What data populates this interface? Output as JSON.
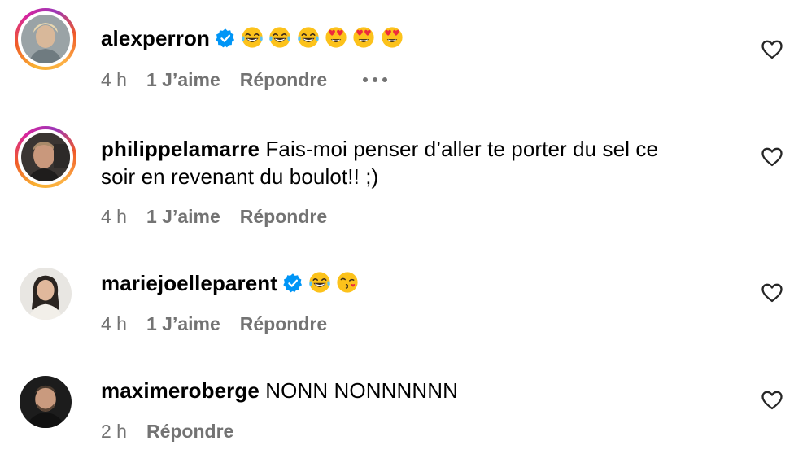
{
  "comments": [
    {
      "username": "alexperron",
      "verified": true,
      "text": "",
      "emojis": [
        "joy",
        "joy",
        "joy",
        "heart-eyes",
        "heart-eyes",
        "heart-eyes"
      ],
      "time": "4 h",
      "likes": "1 J’aime",
      "reply": "Répondre",
      "has_more": true
    },
    {
      "username": "philippelamarre",
      "verified": false,
      "text_line1": "Fais-moi penser d’aller te porter du sel ce",
      "text_line2": "soir en revenant du boulot!! ;)",
      "time": "4 h",
      "likes": "1 J’aime",
      "reply": "Répondre"
    },
    {
      "username": "mariejoelleparent",
      "verified": true,
      "text": "",
      "emojis": [
        "joy",
        "kiss"
      ],
      "time": "4 h",
      "likes": "1 J’aime",
      "reply": "Répondre"
    },
    {
      "username": "maximeroberge",
      "verified": false,
      "text": "NONN NONNNNNN",
      "time": "2 h",
      "reply": "Répondre"
    }
  ],
  "colors": {
    "meta_gray": "#737373",
    "verified_blue": "#0095f6"
  },
  "icons": {
    "verified": "verified-badge-icon",
    "like": "heart-outline-icon",
    "more": "more-dots-icon"
  }
}
